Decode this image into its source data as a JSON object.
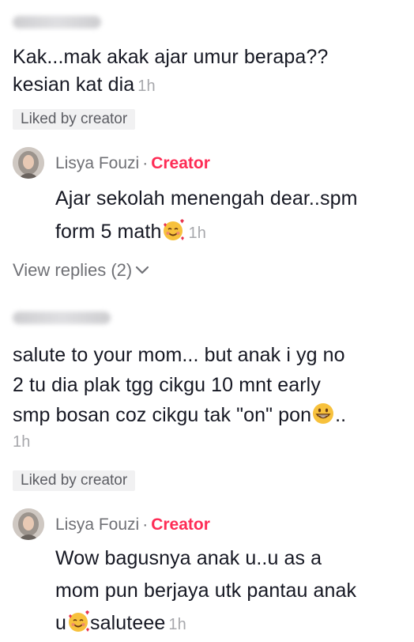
{
  "comments": [
    {
      "text_line1": "Kak...mak akak ajar umur berapa??",
      "text_line2": "kesian kat dia",
      "time": "1h",
      "liked_label": "Liked by creator",
      "reply": {
        "author": "Lisya Fouzi",
        "dot": "·",
        "badge": "Creator",
        "text_line1": "Ajar sekolah menengah dear..spm",
        "text_line2": "form 5 math",
        "time": "1h"
      },
      "view_replies": "View replies (2)"
    },
    {
      "text_line1": "salute to your mom... but anak i yg no",
      "text_line2": "2 tu dia plak tgg cikgu 10 mnt early",
      "text_line3": "smp bosan coz cikgu tak \"on\" pon",
      "text_line3_suffix": "..",
      "time": "1h",
      "liked_label": "Liked by creator",
      "reply": {
        "author": "Lisya Fouzi",
        "dot": "·",
        "badge": "Creator",
        "text_line1": "Wow bagusnya anak u..u as a",
        "text_line2": "mom pun berjaya utk pantau anak",
        "text_line3_prefix": "u",
        "text_line3": "saluteee",
        "time": "1h"
      }
    }
  ],
  "colors": {
    "creator_accent": "#fe2c55",
    "text_primary": "#161823",
    "text_secondary": "#6f7075",
    "badge_bg": "#f1f1f2"
  },
  "icons": {
    "emoji_hearts": "smiling-face-with-hearts-icon",
    "emoji_grin": "grinning-face-icon",
    "chevron": "chevron-down-icon"
  }
}
